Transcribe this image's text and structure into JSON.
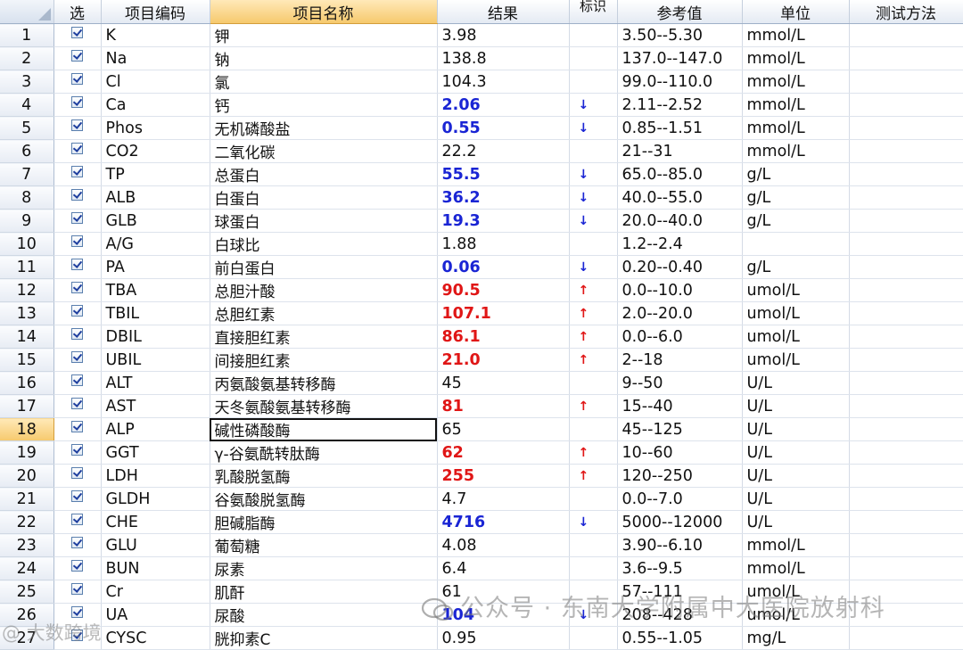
{
  "headers": {
    "select": "选",
    "code": "项目编码",
    "name": "项目名称",
    "result": "结果",
    "flag": "标识",
    "reference": "参考值",
    "unit": "单位",
    "method": "测试方法"
  },
  "selected_row": 18,
  "colors": {
    "low": "#1a25d4",
    "high": "#e01616",
    "header_highlight": "#f6c96d"
  },
  "icons": {
    "checkbox": "checkbox-checked-icon",
    "low_flag": "arrow-down-icon",
    "high_flag": "arrow-up-icon"
  },
  "rows": [
    {
      "n": "1",
      "code": "K",
      "name": "钾",
      "result": "3.98",
      "status": "",
      "flag": "",
      "ref": "3.50--5.30",
      "unit": "mmol/L"
    },
    {
      "n": "2",
      "code": "Na",
      "name": "钠",
      "result": "138.8",
      "status": "",
      "flag": "",
      "ref": "137.0--147.0",
      "unit": "mmol/L"
    },
    {
      "n": "3",
      "code": "Cl",
      "name": "氯",
      "result": "104.3",
      "status": "",
      "flag": "",
      "ref": "99.0--110.0",
      "unit": "mmol/L"
    },
    {
      "n": "4",
      "code": "Ca",
      "name": "钙",
      "result": "2.06",
      "status": "low",
      "flag": "↓",
      "ref": "2.11--2.52",
      "unit": "mmol/L"
    },
    {
      "n": "5",
      "code": "Phos",
      "name": "无机磷酸盐",
      "result": "0.55",
      "status": "low",
      "flag": "↓",
      "ref": "0.85--1.51",
      "unit": "mmol/L"
    },
    {
      "n": "6",
      "code": "CO2",
      "name": "二氧化碳",
      "result": "22.2",
      "status": "",
      "flag": "",
      "ref": "21--31",
      "unit": "mmol/L"
    },
    {
      "n": "7",
      "code": "TP",
      "name": "总蛋白",
      "result": "55.5",
      "status": "low",
      "flag": "↓",
      "ref": "65.0--85.0",
      "unit": "g/L"
    },
    {
      "n": "8",
      "code": "ALB",
      "name": "白蛋白",
      "result": "36.2",
      "status": "low",
      "flag": "↓",
      "ref": "40.0--55.0",
      "unit": "g/L"
    },
    {
      "n": "9",
      "code": "GLB",
      "name": "球蛋白",
      "result": "19.3",
      "status": "low",
      "flag": "↓",
      "ref": "20.0--40.0",
      "unit": "g/L"
    },
    {
      "n": "10",
      "code": "A/G",
      "name": "白球比",
      "result": "1.88",
      "status": "",
      "flag": "",
      "ref": "1.2--2.4",
      "unit": ""
    },
    {
      "n": "11",
      "code": "PA",
      "name": "前白蛋白",
      "result": "0.06",
      "status": "low",
      "flag": "↓",
      "ref": "0.20--0.40",
      "unit": "g/L"
    },
    {
      "n": "12",
      "code": "TBA",
      "name": "总胆汁酸",
      "result": "90.5",
      "status": "high",
      "flag": "↑",
      "ref": "0.0--10.0",
      "unit": "umol/L"
    },
    {
      "n": "13",
      "code": "TBIL",
      "name": "总胆红素",
      "result": "107.1",
      "status": "high",
      "flag": "↑",
      "ref": "2.0--20.0",
      "unit": "umol/L"
    },
    {
      "n": "14",
      "code": "DBIL",
      "name": "直接胆红素",
      "result": "86.1",
      "status": "high",
      "flag": "↑",
      "ref": "0.0--6.0",
      "unit": "umol/L"
    },
    {
      "n": "15",
      "code": "UBIL",
      "name": "间接胆红素",
      "result": "21.0",
      "status": "high",
      "flag": "↑",
      "ref": "2--18",
      "unit": "umol/L"
    },
    {
      "n": "16",
      "code": "ALT",
      "name": "丙氨酸氨基转移酶",
      "result": "45",
      "status": "",
      "flag": "",
      "ref": "9--50",
      "unit": "U/L"
    },
    {
      "n": "17",
      "code": "AST",
      "name": "天冬氨酸氨基转移酶",
      "result": "81",
      "status": "high",
      "flag": "↑",
      "ref": "15--40",
      "unit": "U/L"
    },
    {
      "n": "18",
      "code": "ALP",
      "name": "碱性磷酸酶",
      "result": "65",
      "status": "",
      "flag": "",
      "ref": "45--125",
      "unit": "U/L"
    },
    {
      "n": "19",
      "code": "GGT",
      "name": "γ-谷氨酰转肽酶",
      "result": "62",
      "status": "high",
      "flag": "↑",
      "ref": "10--60",
      "unit": "U/L"
    },
    {
      "n": "20",
      "code": "LDH",
      "name": "乳酸脱氢酶",
      "result": "255",
      "status": "high",
      "flag": "↑",
      "ref": "120--250",
      "unit": "U/L"
    },
    {
      "n": "21",
      "code": "GLDH",
      "name": "谷氨酸脱氢酶",
      "result": "4.7",
      "status": "",
      "flag": "",
      "ref": "0.0--7.0",
      "unit": "U/L"
    },
    {
      "n": "22",
      "code": "CHE",
      "name": "胆碱脂酶",
      "result": "4716",
      "status": "low",
      "flag": "↓",
      "ref": "5000--12000",
      "unit": "U/L"
    },
    {
      "n": "23",
      "code": "GLU",
      "name": "葡萄糖",
      "result": "4.08",
      "status": "",
      "flag": "",
      "ref": "3.90--6.10",
      "unit": "mmol/L"
    },
    {
      "n": "24",
      "code": "BUN",
      "name": "尿素",
      "result": "6.4",
      "status": "",
      "flag": "",
      "ref": "3.6--9.5",
      "unit": "mmol/L"
    },
    {
      "n": "25",
      "code": "Cr",
      "name": "肌酐",
      "result": "61",
      "status": "",
      "flag": "",
      "ref": "57--111",
      "unit": "umol/L"
    },
    {
      "n": "26",
      "code": "UA",
      "name": "尿酸",
      "result": "104",
      "status": "low",
      "flag": "↓",
      "ref": "208--428",
      "unit": "umol/L"
    },
    {
      "n": "27",
      "code": "CYSC",
      "name": "胱抑素C",
      "result": "0.95",
      "status": "",
      "flag": "",
      "ref": "0.55--1.05",
      "unit": "mg/L"
    }
  ],
  "watermark": {
    "text": "公众号 · 东南大学附属中大医院放射科",
    "corner": "@ 大数跨境"
  }
}
